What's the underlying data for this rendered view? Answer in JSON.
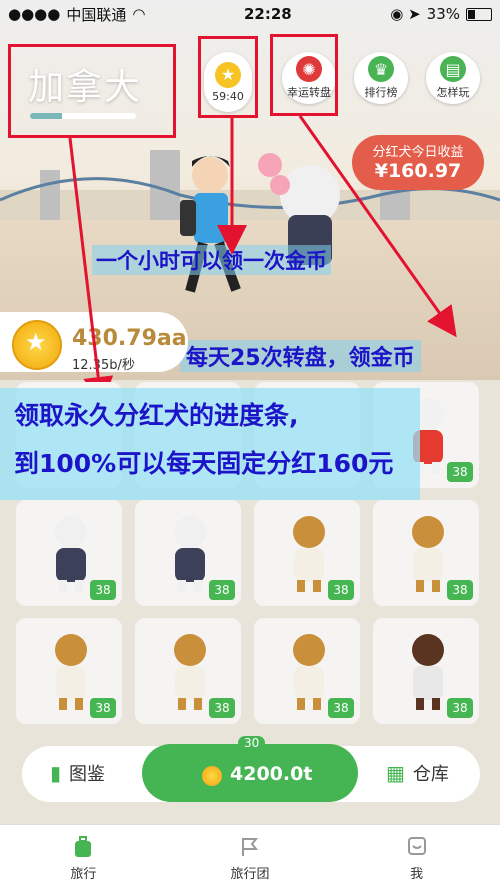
{
  "status": {
    "carrier": "中国联通",
    "time": "22:28",
    "battery": "33%"
  },
  "header": {
    "city": "加拿大",
    "city_progress": 0.3,
    "timer": "59:40",
    "buttons": [
      "幸运转盘",
      "排行榜",
      "怎样玩"
    ]
  },
  "earnings": {
    "title": "分红犬今日收益",
    "value": "¥160.97"
  },
  "coins": {
    "amount": "430.79aa",
    "rate": "12.35b/秒"
  },
  "annotations": {
    "a1": "一个小时可以领一次金币",
    "a2": "每天25次转盘，领金币",
    "a3_line1": "领取永久分红犬的进度条,",
    "a3_line2": "到100%可以每天固定分红160元"
  },
  "grid": {
    "slots": [
      {
        "badge": "",
        "pet": "empty"
      },
      {
        "badge": "",
        "pet": "empty"
      },
      {
        "badge": "",
        "pet": "empty"
      },
      {
        "badge": "38",
        "pet": "lion-dancer"
      },
      {
        "badge": "38",
        "pet": "poodle"
      },
      {
        "badge": "38",
        "pet": "poodle"
      },
      {
        "badge": "38",
        "pet": "chief"
      },
      {
        "badge": "38",
        "pet": "chief"
      },
      {
        "badge": "38",
        "pet": "chief"
      },
      {
        "badge": "38",
        "pet": "chief"
      },
      {
        "badge": "38",
        "pet": "chief"
      },
      {
        "badge": "38",
        "pet": "rottweiler"
      }
    ]
  },
  "bottom": {
    "left_label": "图鉴",
    "right_label": "仓库",
    "center_level": "30",
    "center_amount": "4200.0t"
  },
  "tabs": [
    "旅行",
    "旅行团",
    "我"
  ],
  "colors": {
    "green": "#44b552",
    "annotation": "#1c14c8",
    "red_box": "#e3122f"
  }
}
